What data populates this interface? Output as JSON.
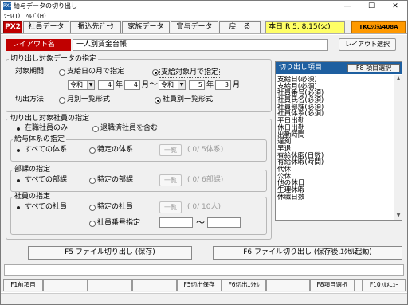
{
  "window": {
    "app_icon": "PX2",
    "title": "給与データの切り出し",
    "minimize": "—",
    "maximize": "☐",
    "close": "✕"
  },
  "menu": [
    "ﾂｰﾙ(T)",
    "ﾍﾙﾌﾟ(H)"
  ],
  "toolbar": {
    "px2": "PX2",
    "buttons": [
      "社員データ",
      "振込先ﾃﾞｰﾀ",
      "家族データ",
      "賞与データ",
      "戻　る"
    ],
    "date": "本日:R 5. 8.15(火)",
    "tkc": "TKCｼｽﾃﾑ408A"
  },
  "layout": {
    "label": "レイアウト名",
    "value": "一人別賃金台帳",
    "select_button": "レイアウト選択"
  },
  "target_data": {
    "title": "切り出し対象データの指定",
    "period_label": "対象期間",
    "period_options": [
      "支給日の月で指定",
      "支給対象月で指定"
    ],
    "period_selected": 1,
    "from_era": "令和",
    "from_year": "4",
    "from_year_unit": "年",
    "from_month": "4",
    "from_month_unit": "月",
    "tilde": "〜",
    "to_era": "令和",
    "to_year": "5",
    "to_year_unit": "年",
    "to_month": "3",
    "to_month_unit": "月",
    "method_label": "切出方法",
    "method_options": [
      "月別一覧形式",
      "社員別一覧形式"
    ],
    "method_selected": 1
  },
  "target_employees": {
    "title": "切り出し対象社員の指定",
    "options": [
      "在職社員のみ",
      "退職済社員を含む"
    ],
    "selected": 0,
    "salary_group": {
      "title": "給与体系の指定",
      "options": [
        "すべての体系",
        "特定の体系"
      ],
      "list_button": "一覧",
      "count": "(  0/  5体系)"
    },
    "dept_group": {
      "title": "部課の指定",
      "options": [
        "すべての部課",
        "特定の部課"
      ],
      "list_button": "一覧",
      "count": "(  0/  6部課)"
    },
    "employee_group": {
      "title": "社員の指定",
      "options": [
        "すべての社員",
        "特定の社員",
        "社員番号指定"
      ],
      "list_button": "一覧",
      "count": "(  0/  10人)",
      "tilde": "〜"
    }
  },
  "items_panel": {
    "title": "切り出し項目",
    "select_button": "F8 項目選択",
    "items": [
      "支給日(必須)",
      "支給月(必須)",
      "社員番号(必須)",
      "社員氏名(必須)",
      "社員部課(必須)",
      "社員体系(必須)",
      "平日出勤",
      "休日出勤",
      "出勤時間",
      "遅刻",
      "早退",
      "有給休暇(日数)",
      "有給休暇(時間)",
      "代休",
      "公休",
      "他の休日",
      "生理休暇",
      "休職日数"
    ]
  },
  "actions": {
    "f5": "F5 ファイル切り出し (保存)",
    "f6": "F6 ファイル切り出し (保存後,ｴｸｾﾙ起動)"
  },
  "fkeys": [
    "F1前項目",
    "",
    "",
    "",
    "F5切出保存",
    "F6切出ｴｸｾﾙ",
    "",
    "F8項目選択",
    "",
    "F10ﾌﾙﾒﾆｭｰ"
  ]
}
